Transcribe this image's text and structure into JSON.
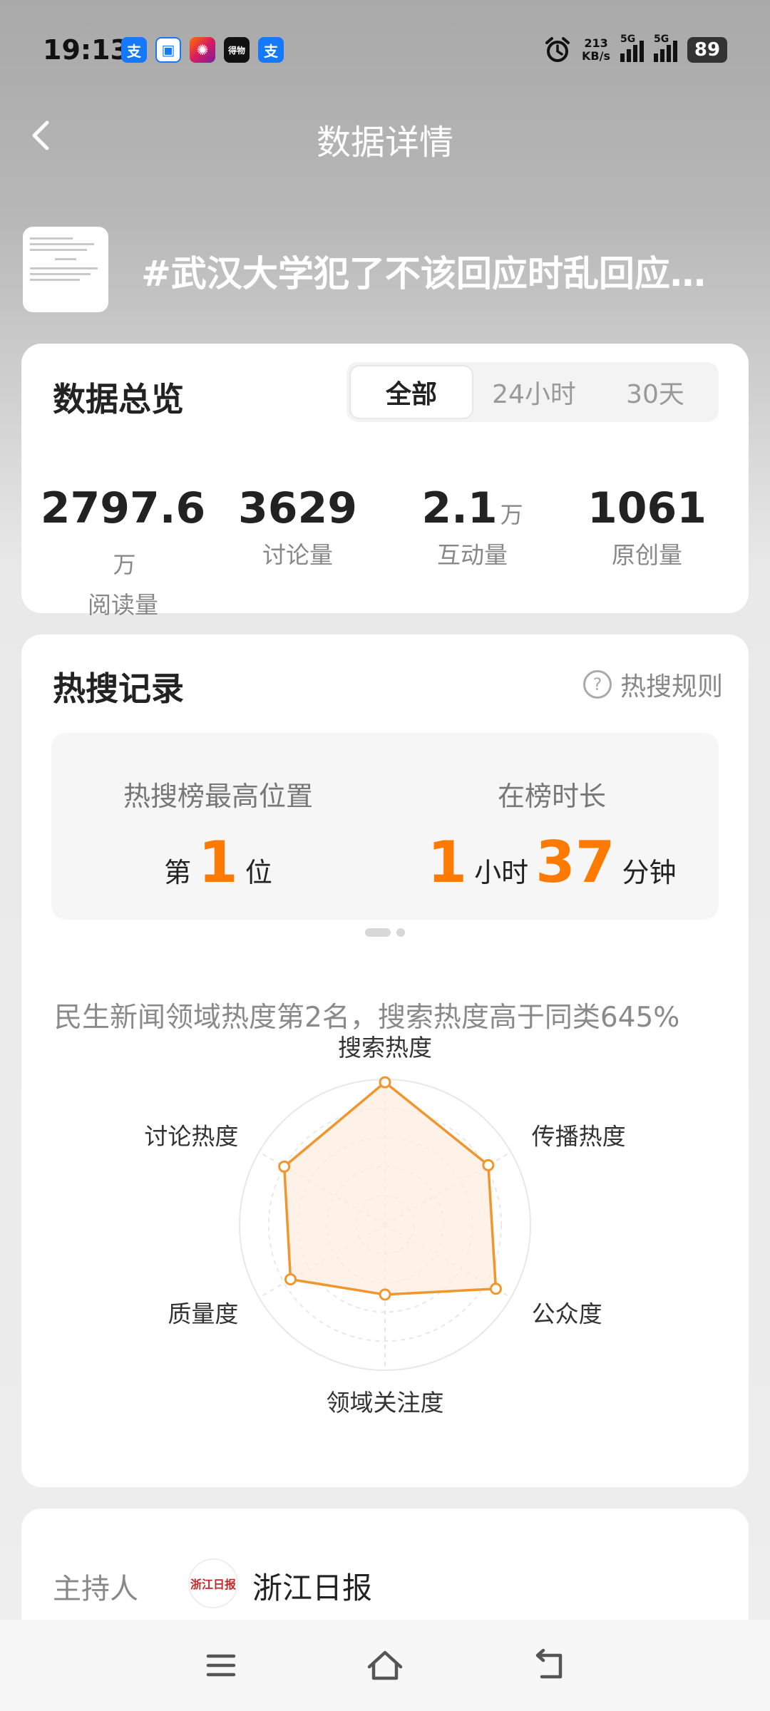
{
  "status_bar": {
    "time": "19:13",
    "net_speed_value": "213",
    "net_speed_unit": "KB/s",
    "sim1": "5G",
    "sim2": "5G",
    "battery": "89",
    "apps": [
      {
        "icon": "alipay-icon",
        "glyph": "支"
      },
      {
        "icon": "chat-app-icon",
        "glyph": "▣"
      },
      {
        "icon": "photo-app-icon",
        "glyph": "✺"
      },
      {
        "icon": "dewu-app-icon",
        "glyph": "得物"
      },
      {
        "icon": "alipay-icon",
        "glyph": "支"
      }
    ]
  },
  "header": {
    "title": "数据详情",
    "back_icon": "back-arrow-icon"
  },
  "topic": {
    "title": "#武汉大学犯了不该回应时乱回应…"
  },
  "overview": {
    "title": "数据总览",
    "tabs": [
      "全部",
      "24小时",
      "30天"
    ],
    "active_tab": "全部",
    "stats": [
      {
        "value": "2797.6",
        "unit": "万",
        "label": "阅读量"
      },
      {
        "value": "3629",
        "unit": "",
        "label": "讨论量"
      },
      {
        "value": "2.1",
        "unit": "万",
        "label": "互动量"
      },
      {
        "value": "1061",
        "unit": "",
        "label": "原创量"
      }
    ]
  },
  "hot_search": {
    "title": "热搜记录",
    "rules_label": "热搜规则",
    "peak_label": "热搜榜最高位置",
    "peak_prefix": "第",
    "peak_value": "1",
    "peak_suffix": "位",
    "duration_label": "在榜时长",
    "duration_hours": "1",
    "duration_hours_unit": "小时",
    "duration_minutes": "37",
    "duration_minutes_unit": "分钟",
    "description": "民生新闻领域热度第2名，搜索热度高于同类645%"
  },
  "chart_data": {
    "type": "radar",
    "axes": [
      "搜索热度",
      "传播热度",
      "公众度",
      "领域关注度",
      "质量度",
      "讨论热度"
    ],
    "values": [
      0.98,
      0.82,
      0.88,
      0.48,
      0.75,
      0.8
    ],
    "scale": [
      0,
      1
    ],
    "rings": 5,
    "color": "#f0962e",
    "fill": "#fdeee0"
  },
  "host": {
    "label": "主持人",
    "name": "浙江日报",
    "avatar_text": "浙江日报"
  },
  "nav_keys": [
    "menu-icon",
    "home-icon",
    "back-icon"
  ]
}
